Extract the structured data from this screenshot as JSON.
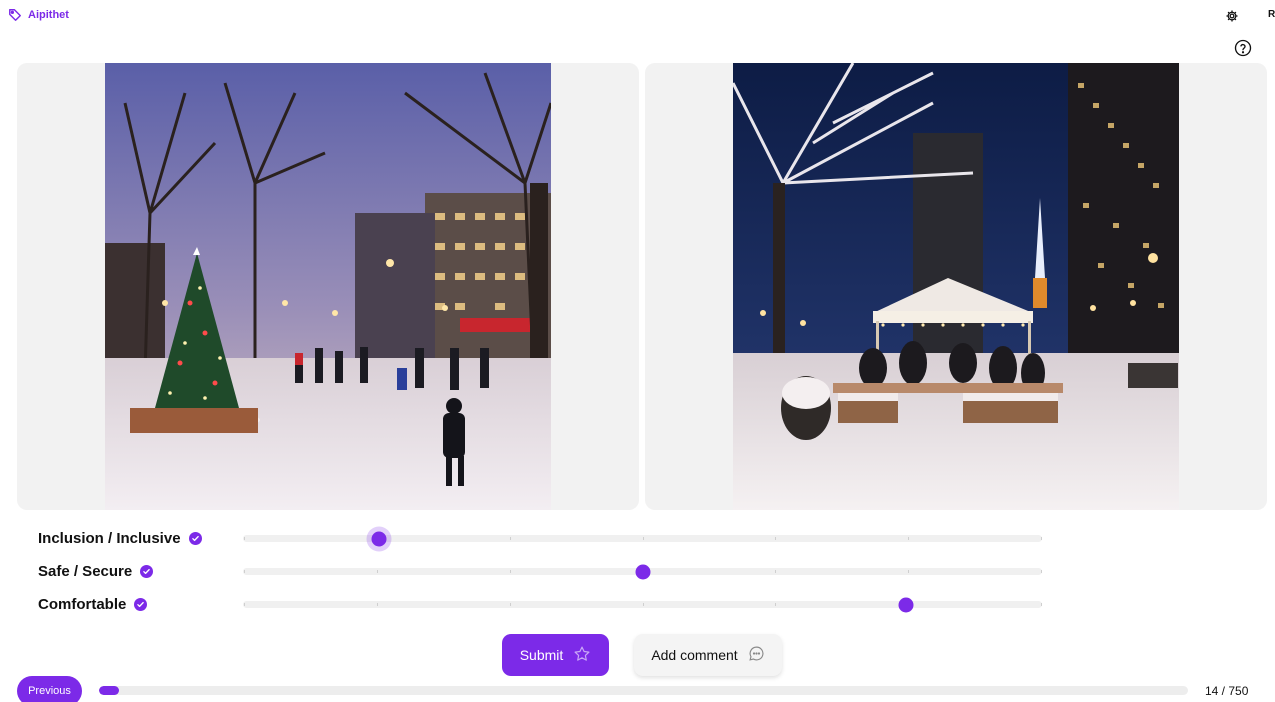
{
  "brand": {
    "name": "Aipithet",
    "icon": "tag-icon"
  },
  "header": {
    "user_initial": "R",
    "settings_icon": "gear-icon",
    "help_icon": "help-circle-icon"
  },
  "images": [
    {
      "name": "winter-park-skating-image"
    },
    {
      "name": "winter-plaza-tent-image"
    }
  ],
  "criteria": [
    {
      "label": "Inclusion / Inclusive",
      "value": 0.17,
      "active": true
    },
    {
      "label": "Safe / Secure",
      "value": 0.5,
      "active": false
    },
    {
      "label": "Comfortable",
      "value": 0.83,
      "active": false
    }
  ],
  "actions": {
    "submit_label": "Submit",
    "submit_icon": "star-icon",
    "comment_label": "Add comment",
    "comment_icon": "comment-icon"
  },
  "footer": {
    "previous_label": "Previous",
    "progress": 0.0187,
    "counter": "14 / 750"
  },
  "colors": {
    "accent": "#7c2ae8"
  }
}
